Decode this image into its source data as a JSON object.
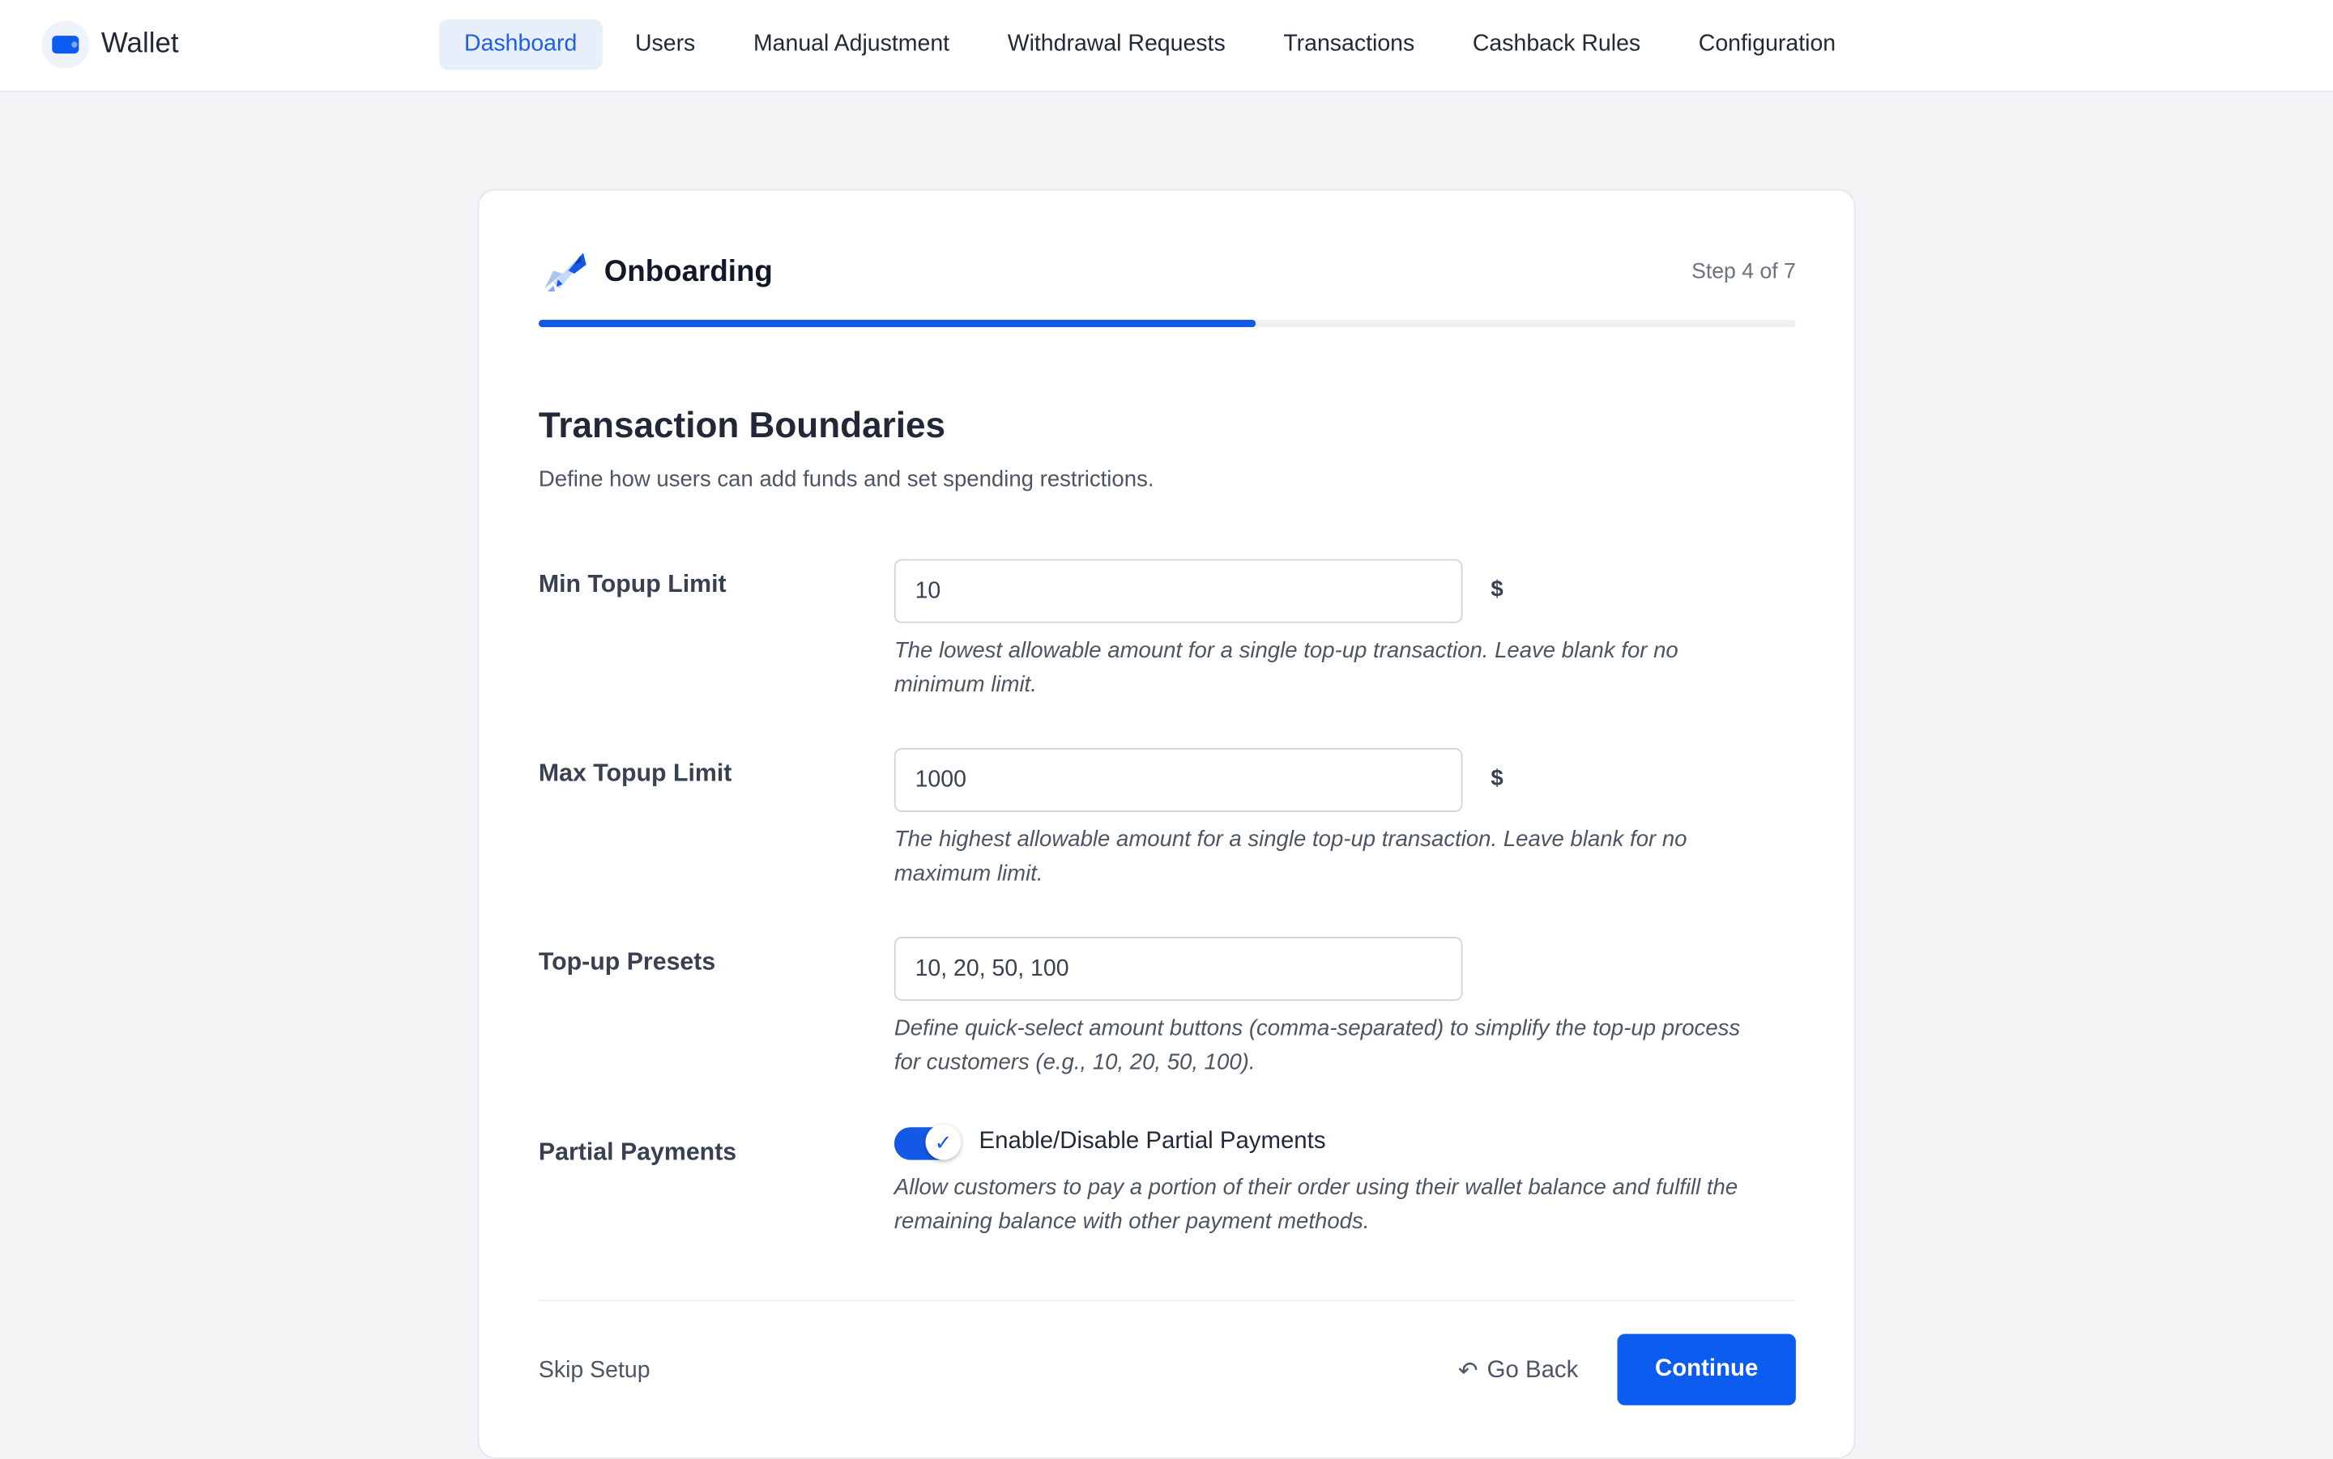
{
  "brand": {
    "name": "Wallet",
    "icon": "wallet-icon",
    "color": "#0d5cf0"
  },
  "nav": [
    {
      "label": "Dashboard",
      "active": true
    },
    {
      "label": "Users"
    },
    {
      "label": "Manual Adjustment"
    },
    {
      "label": "Withdrawal Requests"
    },
    {
      "label": "Transactions"
    },
    {
      "label": "Cashback Rules"
    },
    {
      "label": "Configuration"
    }
  ],
  "onboarding": {
    "title": "Onboarding",
    "icon": "rocket-icon",
    "step_text": "Step 4 of 7",
    "progress": 0.57
  },
  "section": {
    "title": "Transaction Boundaries",
    "subtitle": "Define how users can add funds and set spending restrictions."
  },
  "fields": {
    "min_topup": {
      "label": "Min Topup Limit",
      "value": "10",
      "unit": "$",
      "help": "The lowest allowable amount for a single top-up transaction. Leave blank for no minimum limit."
    },
    "max_topup": {
      "label": "Max Topup Limit",
      "value": "1000",
      "unit": "$",
      "help": "The highest allowable amount for a single top-up transaction. Leave blank for no maximum limit."
    },
    "presets": {
      "label": "Top-up Presets",
      "value": "10, 20, 50, 100",
      "help": "Define quick-select amount buttons (comma-separated) to simplify the top-up process for customers (e.g., 10, 20, 50, 100)."
    },
    "partial_payments": {
      "label": "Partial Payments",
      "enabled": true,
      "toggle_label": "Enable/Disable Partial Payments",
      "help": "Allow customers to pay a portion of their order using their wallet balance and fulfill the remaining balance with other payment methods."
    }
  },
  "footer": {
    "skip_label": "Skip Setup",
    "back_label": "Go Back",
    "back_icon": "reply-arrow-icon",
    "continue_label": "Continue"
  },
  "colors": {
    "accent": "#0d5cf0",
    "active_nav_bg": "#e8effb"
  }
}
